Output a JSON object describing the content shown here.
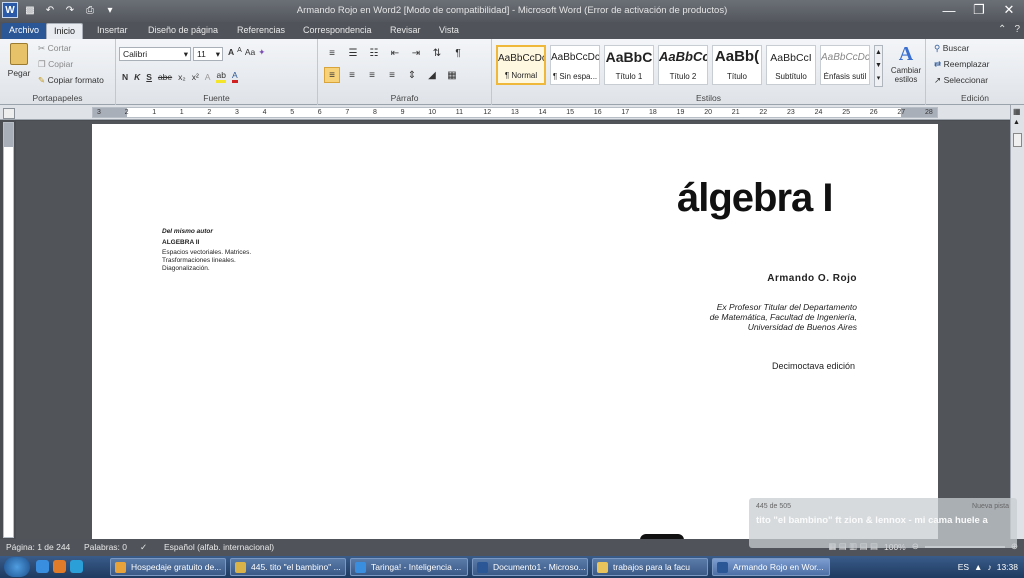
{
  "window": {
    "title": "Armando Rojo en Word2 [Modo de compatibilidad]  -  Microsoft Word (Error de activación de productos)"
  },
  "tabs": [
    "Archivo",
    "Inicio",
    "Insertar",
    "Diseño de página",
    "Referencias",
    "Correspondencia",
    "Revisar",
    "Vista"
  ],
  "ribbon": {
    "portapapeles": {
      "label": "Portapapeles",
      "pegar": "Pegar",
      "cortar": "Cortar",
      "copiar": "Copiar",
      "copiar_formato": "Copiar formato"
    },
    "fuente": {
      "label": "Fuente",
      "font_name": "Calibri",
      "font_size": "11",
      "grow": "A",
      "shrink": "A",
      "case": "Aa",
      "bold": "N",
      "italic": "K",
      "underline": "S",
      "strike": "abe",
      "subscript": "x₂",
      "superscript": "x²",
      "highlight": "ab",
      "color": "A"
    },
    "parrafo": {
      "label": "Párrafo"
    },
    "estilos": {
      "label": "Estilos",
      "items": [
        {
          "sample": "AaBbCcDc",
          "name": "¶ Normal"
        },
        {
          "sample": "AaBbCcDc",
          "name": "¶ Sin espa..."
        },
        {
          "sample": "AaBbC",
          "name": "Título 1"
        },
        {
          "sample": "AaBbCc",
          "name": "Título 2"
        },
        {
          "sample": "AaBb(",
          "name": "Título"
        },
        {
          "sample": "AaBbCcI",
          "name": "Subtítulo"
        },
        {
          "sample": "AaBbCcDc",
          "name": "Énfasis sutil"
        }
      ],
      "cambiar": "Cambiar estilos"
    },
    "edicion": {
      "label": "Edición",
      "buscar": "Buscar",
      "reemplazar": "Reemplazar",
      "seleccionar": "Seleccionar"
    }
  },
  "ruler": {
    "ticks": [
      "3",
      "2",
      "1",
      "1",
      "2",
      "3",
      "4",
      "5",
      "6",
      "7",
      "8",
      "9",
      "10",
      "11",
      "12",
      "13",
      "14",
      "15",
      "16",
      "17",
      "18",
      "19",
      "20",
      "21",
      "22",
      "23",
      "24",
      "25",
      "26",
      "27",
      "28"
    ]
  },
  "document": {
    "title": "álgebra I",
    "author": "Armando O. Rojo",
    "affiliation": [
      "Ex Profesor Titular del Departamento",
      "de Matemática, Facultad de Ingeniería,",
      "Universidad de Buenos Aires"
    ],
    "edition": "Decimoctava edición",
    "same_author_heading": "Del mismo autor",
    "same_author_book": "ALGEBRA II",
    "same_author_topics": [
      "Espacios vectoriales. Matrices.",
      "Trasformaciones lineales.",
      "Diagonalización."
    ]
  },
  "status": {
    "page": "Página: 1 de 244",
    "words": "Palabras: 0",
    "language": "Español (alfab. internacional)",
    "zoom": "100%"
  },
  "toast": {
    "count": "445 de 505",
    "next": "Nueva pista",
    "song": "tito \"el bambino\" ft zion & lennox - mi cama huele a"
  },
  "taskbar": {
    "items": [
      {
        "label": "Hospedaje gratuito de...",
        "color": "#e8a23a"
      },
      {
        "label": "445. tito \"el bambino\" ...",
        "color": "#d9b24a"
      },
      {
        "label": "Taringa! - Inteligencia ...",
        "color": "#3a8ee0"
      },
      {
        "label": "Documento1 - Microso...",
        "color": "#2b5797"
      },
      {
        "label": "trabajos para la facu",
        "color": "#e8c25a"
      },
      {
        "label": "Armando Rojo en Wor...",
        "color": "#2b5797"
      }
    ],
    "lang": "ES",
    "clock": "13:38"
  }
}
